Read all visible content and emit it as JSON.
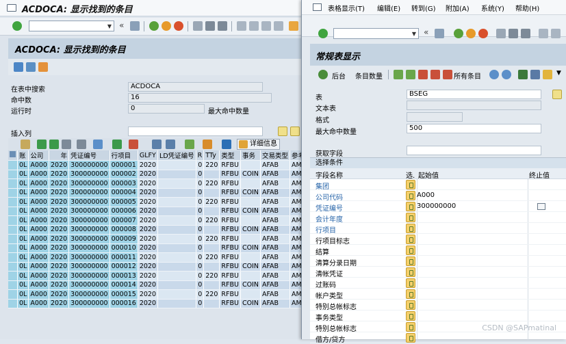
{
  "left_window": {
    "title": "ACDOCA: 显示找到的条目",
    "header_title": "ACDOCA: 显示找到的条目",
    "fields": {
      "search_in_table_label": "在表中搜索",
      "search_in_table_value": "ACDOCA",
      "hits_label": "命中数",
      "hits_value": "16",
      "runtime_label": "运行时",
      "runtime_value": "0",
      "max_hits_label": "最大命中数量",
      "insert_column_label": "插入列"
    },
    "grid_toolbar": {
      "details_label": "详细信息"
    },
    "grid": {
      "columns": [
        "账",
        "公司",
        "年",
        "凭证编号",
        "行项目",
        "GLFY",
        "LD凭证编号",
        "R",
        "TTy",
        "类型",
        "事务",
        "交易类型",
        "参考"
      ],
      "rows": [
        [
          "0L",
          "A000",
          "2020",
          "300000000",
          "000001",
          "2020",
          "",
          "0",
          "220",
          "RFBU",
          "",
          "AFAB",
          "AMI"
        ],
        [
          "0L",
          "A000",
          "2020",
          "300000000",
          "000002",
          "2020",
          "",
          "0",
          "",
          "RFBU",
          "COIN",
          "AFAB",
          "AMI"
        ],
        [
          "0L",
          "A000",
          "2020",
          "300000000",
          "000003",
          "2020",
          "",
          "0",
          "220",
          "RFBU",
          "",
          "AFAB",
          "AMI"
        ],
        [
          "0L",
          "A000",
          "2020",
          "300000000",
          "000004",
          "2020",
          "",
          "0",
          "",
          "RFBU",
          "COIN",
          "AFAB",
          "AMI"
        ],
        [
          "0L",
          "A000",
          "2020",
          "300000000",
          "000005",
          "2020",
          "",
          "0",
          "220",
          "RFBU",
          "",
          "AFAB",
          "AMI"
        ],
        [
          "0L",
          "A000",
          "2020",
          "300000000",
          "000006",
          "2020",
          "",
          "0",
          "",
          "RFBU",
          "COIN",
          "AFAB",
          "AMI"
        ],
        [
          "0L",
          "A000",
          "2020",
          "300000000",
          "000007",
          "2020",
          "",
          "0",
          "220",
          "RFBU",
          "",
          "AFAB",
          "AMI"
        ],
        [
          "0L",
          "A000",
          "2020",
          "300000000",
          "000008",
          "2020",
          "",
          "0",
          "",
          "RFBU",
          "COIN",
          "AFAB",
          "AMI"
        ],
        [
          "0L",
          "A000",
          "2020",
          "300000000",
          "000009",
          "2020",
          "",
          "0",
          "220",
          "RFBU",
          "",
          "AFAB",
          "AMI"
        ],
        [
          "0L",
          "A000",
          "2020",
          "300000000",
          "000010",
          "2020",
          "",
          "0",
          "",
          "RFBU",
          "COIN",
          "AFAB",
          "AMI"
        ],
        [
          "0L",
          "A000",
          "2020",
          "300000000",
          "000011",
          "2020",
          "",
          "0",
          "220",
          "RFBU",
          "",
          "AFAB",
          "AMI"
        ],
        [
          "0L",
          "A000",
          "2020",
          "300000000",
          "000012",
          "2020",
          "",
          "0",
          "",
          "RFBU",
          "COIN",
          "AFAB",
          "AMI"
        ],
        [
          "0L",
          "A000",
          "2020",
          "300000000",
          "000013",
          "2020",
          "",
          "0",
          "220",
          "RFBU",
          "",
          "AFAB",
          "AMI"
        ],
        [
          "0L",
          "A000",
          "2020",
          "300000000",
          "000014",
          "2020",
          "",
          "0",
          "",
          "RFBU",
          "COIN",
          "AFAB",
          "AMI"
        ],
        [
          "0L",
          "A000",
          "2020",
          "300000000",
          "000015",
          "2020",
          "",
          "0",
          "220",
          "RFBU",
          "",
          "AFAB",
          "AMI"
        ],
        [
          "0L",
          "A000",
          "2020",
          "300000000",
          "000016",
          "2020",
          "",
          "0",
          "",
          "RFBU",
          "COIN",
          "AFAB",
          "AMI"
        ]
      ]
    }
  },
  "right_window": {
    "menu": [
      "表格显示(T)",
      "编辑(E)",
      "转到(G)",
      "附加(A)",
      "系统(Y)",
      "帮助(H)"
    ],
    "header_title": "常规表显示",
    "app_toolbar": {
      "background_label": "后台",
      "entry_count_label": "条目数量",
      "all_entries_label": "所有条目"
    },
    "fields": {
      "table_label": "表",
      "table_value": "BSEG",
      "text_table_label": "文本表",
      "format_label": "格式",
      "max_hits_label": "最大命中数量",
      "max_hits_value": "500",
      "get_field_label": "获取字段"
    },
    "selection": {
      "title": "选择条件",
      "col_field_name": "字段名称",
      "col_sel": "选.",
      "col_low": "起始值",
      "col_high": "终止值",
      "rows": [
        {
          "name": "集团",
          "link": true,
          "low": ""
        },
        {
          "name": "公司代码",
          "link": true,
          "low": "A000"
        },
        {
          "name": "凭证编号",
          "link": true,
          "low": "300000000"
        },
        {
          "name": "会计年度",
          "link": true,
          "low": ""
        },
        {
          "name": "行项目",
          "link": true,
          "low": ""
        },
        {
          "name": "行项目标志",
          "link": false,
          "low": ""
        },
        {
          "name": "结算",
          "link": false,
          "low": ""
        },
        {
          "name": "清算分录日期",
          "link": false,
          "low": ""
        },
        {
          "name": "清帐凭证",
          "link": false,
          "low": ""
        },
        {
          "name": "过账码",
          "link": false,
          "low": ""
        },
        {
          "name": "帐户类型",
          "link": false,
          "low": ""
        },
        {
          "name": "特别总帐标志",
          "link": false,
          "low": ""
        },
        {
          "name": "事务类型",
          "link": false,
          "low": ""
        },
        {
          "name": "特别总帐标志",
          "link": false,
          "low": ""
        },
        {
          "name": "借方/贷方",
          "link": false,
          "low": ""
        }
      ]
    }
  },
  "watermark": "CSDN @SAPmatinal"
}
